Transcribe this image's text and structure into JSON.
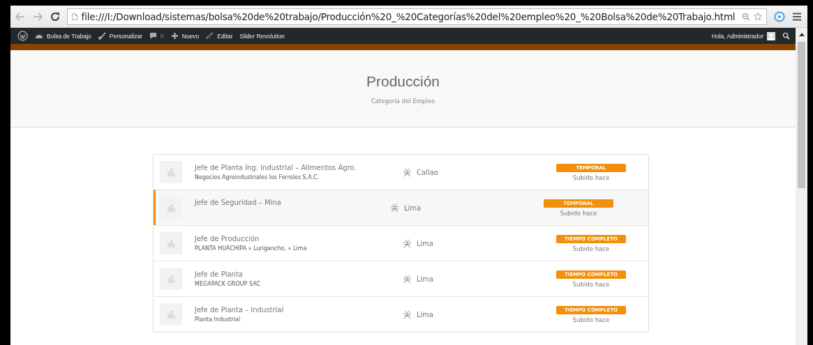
{
  "browser": {
    "url": "file:///I:/Download/sistemas/bolsa%20de%20trabajo/Producción%20_%20Categorías%20del%20empleo%20_%20Bolsa%20de%20Trabajo.html"
  },
  "admin_bar": {
    "items": [
      {
        "kind": "site",
        "label": "Bolsa de Trabajo"
      },
      {
        "kind": "customize",
        "label": "Personalizar"
      },
      {
        "kind": "comments",
        "label": "0"
      },
      {
        "kind": "new",
        "label": "Nuevo"
      },
      {
        "kind": "edit",
        "label": "Editar"
      },
      {
        "kind": "plain",
        "label": "Slider Revolution"
      }
    ],
    "greeting": "Hola, Administrador"
  },
  "header": {
    "title": "Producción",
    "subtitle": "Categoría del Empleo"
  },
  "jobs": [
    {
      "title": "Jefe de Planta Ing. Industrial – Alimentos Agro.",
      "company": "Negocios Agroindustriales los Ferroles S.A.C.",
      "location": "Callao",
      "type": "TEMPORAL",
      "posted": "Subido hace",
      "selected": false
    },
    {
      "title": "Jefe de Seguridad – Mina",
      "location": "Lima",
      "type": "TEMPORAL",
      "posted": "Subido hace",
      "selected": true
    },
    {
      "title": "Jefe de Producción",
      "company": "PLANTA HUACHIPA » Lurigancho, » Lima",
      "location": "Lima",
      "type": "TIEMPO COMPLETO",
      "posted": "Subido hace",
      "selected": false
    },
    {
      "title": "Jefe de Planta",
      "company": "MEGAPACK GROUP SAC",
      "location": "Lima",
      "type": "TIEMPO COMPLETO",
      "posted": "Subido hace",
      "selected": false
    },
    {
      "title": "Jefe de Planta – Industrial",
      "company": "Planta Industrial",
      "location": "Lima",
      "type": "TIEMPO COMPLETO",
      "posted": "Subido hace",
      "selected": false
    }
  ]
}
